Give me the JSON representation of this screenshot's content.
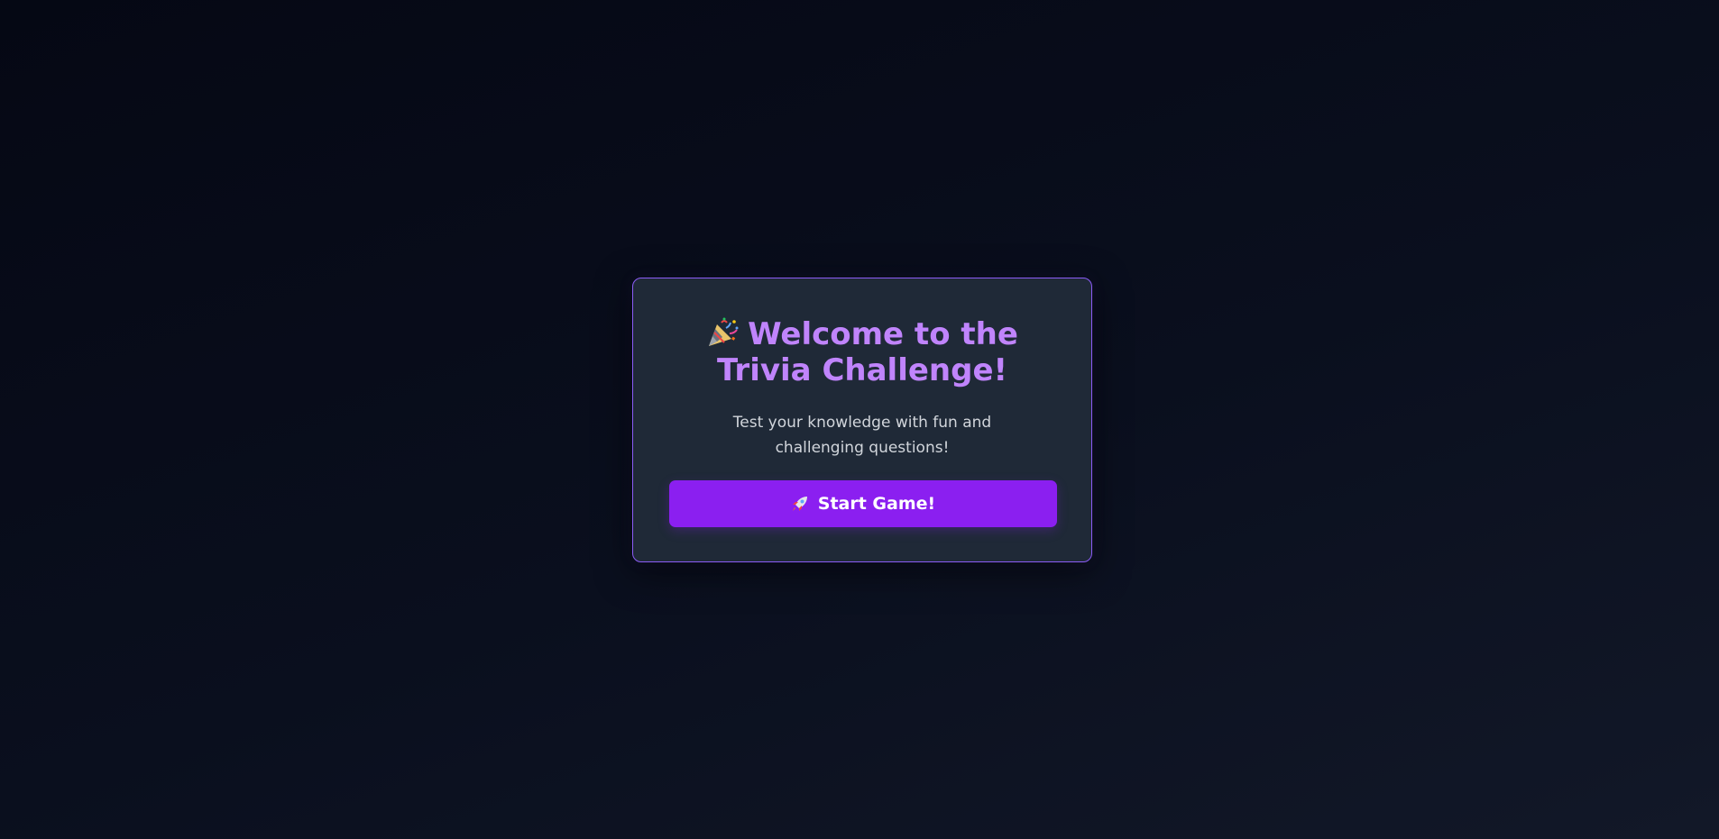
{
  "welcome": {
    "title_line1": "Welcome to the",
    "title_line2": "Trivia Challenge!",
    "title_icon": "party-popper-icon",
    "subtitle": "Test your knowledge with fun and challenging questions!",
    "start_button": {
      "label": "Start Game!",
      "icon": "rocket-icon"
    }
  },
  "colors": {
    "background": "#0a0f1e",
    "card": "#1f2937",
    "card_border": "#8b5cf6",
    "title": "#c084fc",
    "subtitle": "#d1d5db",
    "button": "#8b1ff0",
    "button_text": "#ffffff"
  }
}
